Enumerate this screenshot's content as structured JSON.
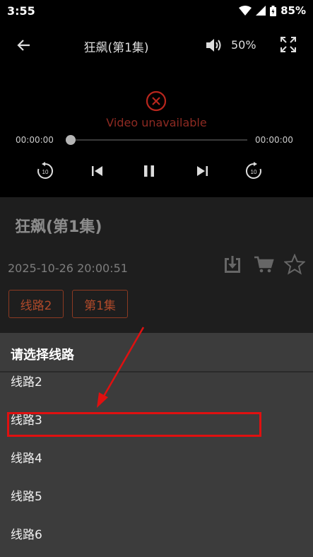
{
  "status_bar": {
    "time": "3:55",
    "battery": "85%"
  },
  "player": {
    "title": "狂飙(第1集)",
    "volume": "50%",
    "error_text": "Video unavailable",
    "current_time": "00:00:00",
    "total_time": "00:00:00"
  },
  "details": {
    "title": "狂飙(第1集)",
    "date": "2025-10-26 20:00:51",
    "chips": [
      "线路2",
      "第1集"
    ]
  },
  "dialog": {
    "title": "请选择线路",
    "routes": [
      "线路2",
      "线路3",
      "线路4",
      "线路5",
      "线路6"
    ]
  },
  "colors": {
    "accent": "#b04a2a",
    "highlight": "#e01010",
    "dialog_bg": "#3c3c3c"
  }
}
